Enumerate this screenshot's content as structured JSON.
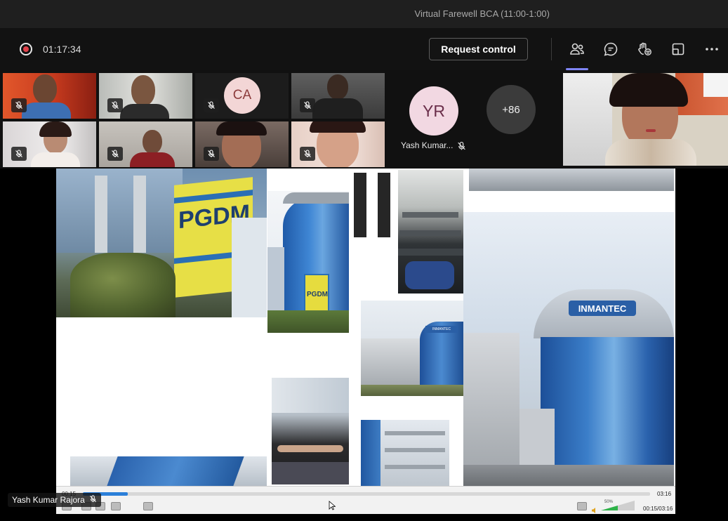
{
  "window": {
    "title": "Virtual Farewell BCA (11:00-1:00)"
  },
  "toolbar": {
    "timer": "01:17:34",
    "request_control_label": "Request control",
    "icons": [
      "people-icon",
      "chat-icon",
      "reactions-icon",
      "share-tray-icon",
      "more-icon"
    ]
  },
  "participants": {
    "ca_initials": "CA",
    "yr_initials": "YR",
    "yr_name": "Yash Kumar...",
    "overflow_count": "+86"
  },
  "presenter": {
    "name": "Yash Kumar Rajora"
  },
  "slide": {
    "sign_pgdm": "PGDM",
    "sign_pgdm_small": "PGDM",
    "building_sign": "INMANTEC",
    "building_sign_small": "INMANTEC"
  },
  "player": {
    "elapsed": "00:15",
    "duration": "03:16",
    "counter": "00:15/03:16",
    "volume": "50%",
    "progress_fraction": 0.079
  },
  "colors": {
    "accent": "#7f85f5",
    "record": "#e0414a",
    "progress": "#2b7fd9"
  }
}
